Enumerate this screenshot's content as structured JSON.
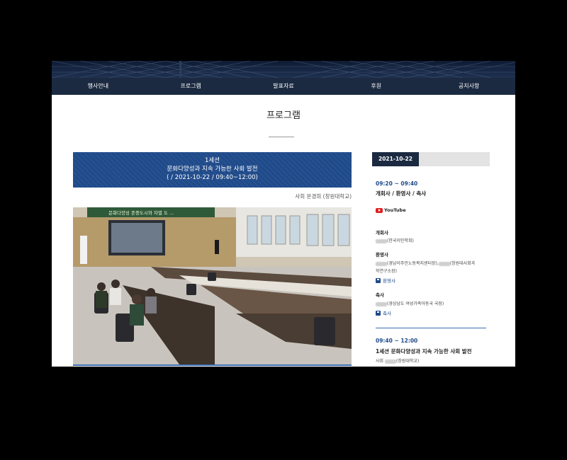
{
  "nav": {
    "items": [
      "행사안내",
      "프로그램",
      "발표자료",
      "후원",
      "공지사항"
    ]
  },
  "page_title": "프로그램",
  "session": {
    "line1": "1세션",
    "line2": "문화다양성과 지속 가능한 사회 발전",
    "line3": "( / 2021-10-22 / 09:40~12:00)"
  },
  "moderator": "사회 문경희 (창원대학교)",
  "video": {
    "banner_text": "문화다양성 존중도시와 차별 도 ..."
  },
  "sidebar": {
    "date_tab": "2021-10-22",
    "block1": {
      "time": "09:20 ~ 09:40",
      "title": "개회사 / 환영사 / 축사",
      "youtube": "YouTube",
      "opening_label": "개회사",
      "opening_person": "(한국이민학회)",
      "welcome_label": "환영사",
      "welcome_person_a": "(경남이주민노동복지센터장),",
      "welcome_person_b": "(창원대사회과",
      "welcome_person_c": "학연구소장)",
      "welcome_link": "환영사",
      "congrats_label": "축사",
      "congrats_person": "(경상남도 여성가족아동국 국장)",
      "congrats_link": "축사"
    },
    "block2": {
      "time": "09:40 ~ 12:00",
      "title": "1세션 문화다양성과 지속 가능한 사회 발전",
      "moderator_prefix": "사회",
      "moderator_suffix": "(창원대학교)"
    }
  },
  "colors": {
    "nav_bg": "#1b2a41",
    "banner_bg": "#1f4a8a",
    "accent": "#1f4a8a",
    "youtube_red": "#e02020"
  }
}
